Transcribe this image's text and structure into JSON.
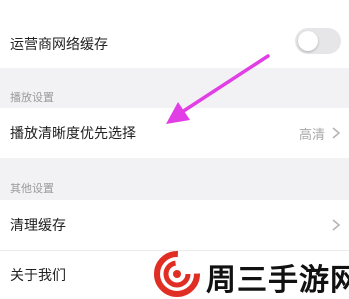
{
  "settings": {
    "carrier_cache": {
      "label": "运营商网络缓存",
      "enabled": false
    },
    "playback_section": {
      "title": "播放设置"
    },
    "playback_quality": {
      "label": "播放清晰度优先选择",
      "value": "高清"
    },
    "other_section": {
      "title": "其他设置"
    },
    "clear_cache": {
      "label": "清理缓存"
    },
    "about_us": {
      "label": "关于我们"
    }
  },
  "icons": {
    "chevron": "chevron-right-icon",
    "annotation_arrow": "arrow-icon"
  },
  "watermark": {
    "text": "周三手游网"
  },
  "colors": {
    "arrow": "#e23ee6",
    "watermark_red": "#e02e24",
    "toggle_off": "#e6e6e8",
    "section_text": "#9a9a9a",
    "value_text": "#a8a8a8"
  }
}
